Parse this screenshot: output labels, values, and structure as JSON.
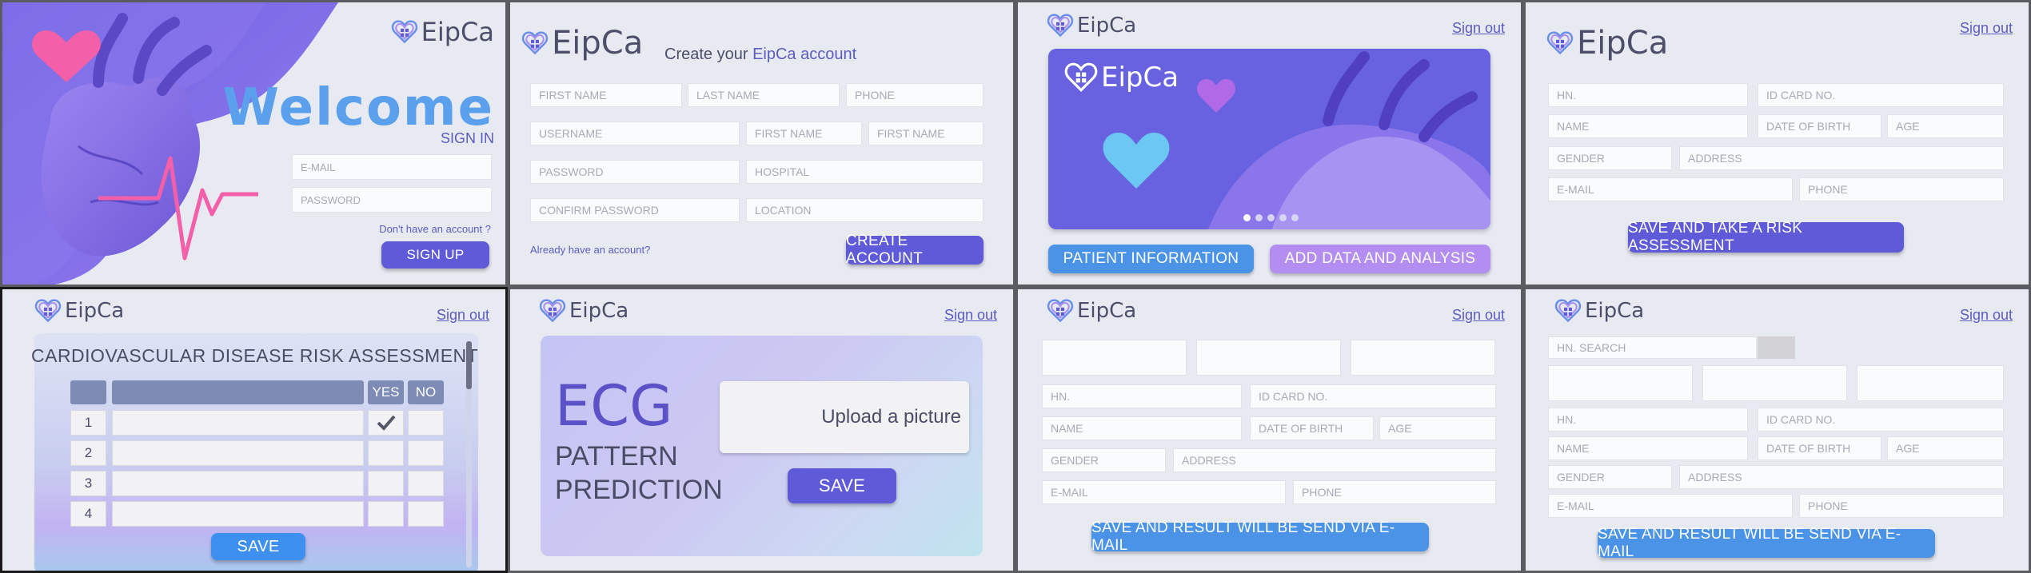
{
  "brand": "EipCa",
  "colors": {
    "primary": "#5e5ad8",
    "blue": "#4a93e6",
    "lavender": "#b38ef0",
    "background": "#e8eaf2",
    "heart_pink": "#f05fa8"
  },
  "s1": {
    "welcome": "Welcome",
    "signin": "SIGN IN",
    "email_ph": "E-MAIL",
    "password_ph": "PASSWORD",
    "no_account": "Don't have an account ?",
    "signup": "SIGN UP"
  },
  "s2": {
    "create_prefix": "Create your",
    "create_brand": "EipCa account",
    "fields": [
      "FIRST NAME",
      "LAST NAME",
      "PHONE",
      "USERNAME",
      "FIRST NAME",
      "FIRST NAME",
      "PASSWORD",
      "HOSPITAL",
      "CONFIRM PASSWORD",
      "LOCATION"
    ],
    "already": "Already have an account?",
    "create_btn": "CREATE ACCOUNT"
  },
  "s3": {
    "signout": "Sign out",
    "patient_info": "PATIENT INFORMATION",
    "add_data": "ADD DATA AND ANALYSIS",
    "carousel_dots": 5,
    "active_dot": 1
  },
  "s4": {
    "signout": "Sign out",
    "fields": [
      "HN.",
      "ID CARD NO.",
      "NAME",
      "DATE OF BIRTH",
      "AGE",
      "GENDER",
      "ADDRESS",
      "E-MAIL",
      "PHONE"
    ],
    "save_btn": "SAVE AND TAKE A RISK ASSESSMENT"
  },
  "s5": {
    "signout": "Sign out",
    "title": "CARDIOVASCULAR DISEASE RISK ASSESSMENT",
    "yes": "YES",
    "no": "NO",
    "rows": [
      "1",
      "2",
      "3",
      "4"
    ],
    "checked_row": 0,
    "save": "SAVE"
  },
  "s6": {
    "signout": "Sign out",
    "ecg": "ECG",
    "pattern": "PATTERN",
    "prediction": "PREDICTION",
    "upload": "Upload a picture",
    "save": "SAVE"
  },
  "s7": {
    "signout": "Sign out",
    "fields": [
      "HN.",
      "ID CARD NO.",
      "NAME",
      "DATE OF BIRTH",
      "AGE",
      "GENDER",
      "ADDRESS",
      "E-MAIL",
      "PHONE"
    ],
    "save_btn": "SAVE AND RESULT WILL BE SEND VIA E-MAIL"
  },
  "s8": {
    "signout": "Sign out",
    "search_ph": "HN. SEARCH",
    "fields": [
      "HN.",
      "ID CARD NO.",
      "NAME",
      "DATE OF BIRTH",
      "AGE",
      "GENDER",
      "ADDRESS",
      "E-MAIL",
      "PHONE"
    ],
    "save_btn": "SAVE AND RESULT WILL BE SEND VIA E-MAIL"
  }
}
